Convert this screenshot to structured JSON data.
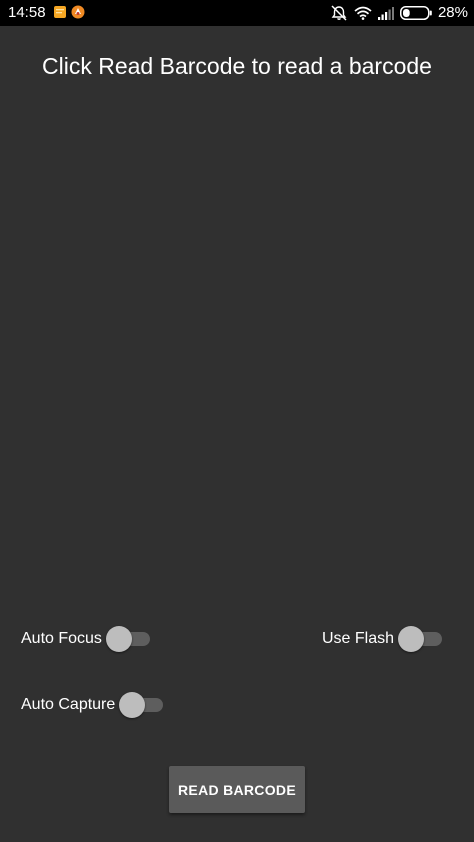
{
  "status_bar": {
    "time": "14:58",
    "battery_percent": "28%",
    "battery_level": 0.28,
    "notification_icons": [
      "note-icon",
      "app-notification-icon"
    ],
    "status_icons": [
      "do-not-disturb-icon",
      "wifi-icon",
      "signal-icon",
      "battery-icon"
    ]
  },
  "main": {
    "title": "Click Read Barcode to read a barcode"
  },
  "toggles": {
    "auto_focus": {
      "label": "Auto Focus",
      "on": false
    },
    "use_flash": {
      "label": "Use Flash",
      "on": false
    },
    "auto_capture": {
      "label": "Auto Capture",
      "on": false
    }
  },
  "actions": {
    "read_barcode_label": "READ BARCODE"
  },
  "colors": {
    "background": "#303030",
    "status_bar": "#000000",
    "switch_track_off": "#5e5e5e",
    "switch_thumb_off": "#bdbdbd",
    "button_background": "#5a5a5a"
  }
}
